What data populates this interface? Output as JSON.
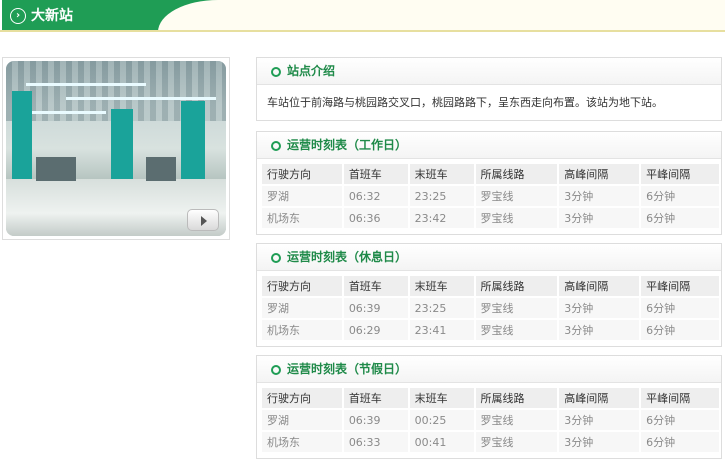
{
  "header": {
    "title": "大新站",
    "icon": "circle-chevron-right-icon"
  },
  "photo": {
    "icon": "play-icon"
  },
  "intro": {
    "title": "站点介绍",
    "text": "车站位于前海路与桃园路交叉口，桃园路路下，呈东西走向布置。该站为地下站。"
  },
  "schedules": [
    {
      "title": "运营时刻表（工作日）",
      "headers": [
        "行驶方向",
        "首班车",
        "末班车",
        "所属线路",
        "高峰间隔",
        "平峰间隔"
      ],
      "rows": [
        [
          "罗湖",
          "06:32",
          "23:25",
          "罗宝线",
          "3分钟",
          "6分钟"
        ],
        [
          "机场东",
          "06:36",
          "23:42",
          "罗宝线",
          "3分钟",
          "6分钟"
        ]
      ]
    },
    {
      "title": "运营时刻表（休息日）",
      "headers": [
        "行驶方向",
        "首班车",
        "末班车",
        "所属线路",
        "高峰间隔",
        "平峰间隔"
      ],
      "rows": [
        [
          "罗湖",
          "06:39",
          "23:25",
          "罗宝线",
          "3分钟",
          "6分钟"
        ],
        [
          "机场东",
          "06:29",
          "23:41",
          "罗宝线",
          "3分钟",
          "6分钟"
        ]
      ]
    },
    {
      "title": "运营时刻表（节假日）",
      "headers": [
        "行驶方向",
        "首班车",
        "末班车",
        "所属线路",
        "高峰间隔",
        "平峰间隔"
      ],
      "rows": [
        [
          "罗湖",
          "06:39",
          "00:25",
          "罗宝线",
          "3分钟",
          "6分钟"
        ],
        [
          "机场东",
          "06:33",
          "00:41",
          "罗宝线",
          "3分钟",
          "6分钟"
        ]
      ]
    }
  ],
  "colors": {
    "brand_green": "#1f9d55",
    "title_green": "#1f8a49",
    "header_cream": "#fffdf2",
    "border": "#dddddd"
  }
}
